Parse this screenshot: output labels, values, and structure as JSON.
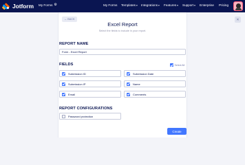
{
  "topbar": {
    "brand": "Jotform",
    "my_forms": "My Forms",
    "nav": [
      "My Forms",
      "Templates",
      "Integrations",
      "Features",
      "Support",
      "Enterprise",
      "Pricing"
    ],
    "nav_dropdowns": [
      false,
      true,
      true,
      true,
      true,
      false,
      false
    ]
  },
  "page": {
    "back_label": "BACK",
    "title": "Excel Report",
    "subtitle": "Select the fields to include in your report.",
    "report_name_label": "REPORT NAME",
    "report_name_value": "Form - Excel Report",
    "fields_label": "FIELDS",
    "select_all_label": "Select All",
    "fields": [
      {
        "label": "Submission ID",
        "checked": true
      },
      {
        "label": "Submission Date",
        "checked": true
      },
      {
        "label": "Submission IP",
        "checked": true
      },
      {
        "label": "Name",
        "checked": true
      },
      {
        "label": "Email",
        "checked": true
      },
      {
        "label": "Comments",
        "checked": true
      }
    ],
    "config_label": "REPORT CONFIGURATIONS",
    "password_label": "Password protection",
    "password_checked": false,
    "create_label": "Create"
  },
  "colors": {
    "topbar_bg": "#0a1551",
    "accent": "#4277ff",
    "background": "#f3f4f9"
  }
}
